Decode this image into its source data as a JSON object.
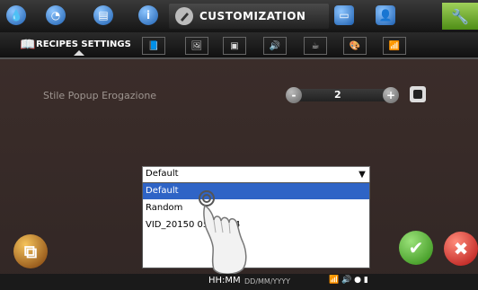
{
  "top": {
    "active_tab": "CUSTOMIZATION",
    "icons": [
      "water-drop-icon",
      "clock-icon",
      "card-icon",
      "info-icon",
      "monitor-icon",
      "user-icon",
      "wrench-icon"
    ]
  },
  "subnav": {
    "active": "RECIPES SETTINGS",
    "icons": [
      "book-icon",
      "image-icon",
      "screen-icon",
      "speaker-icon",
      "cup-icon",
      "palette-icon",
      "wifi-icon"
    ]
  },
  "setting": {
    "label": "Stile Popup Erogazione",
    "value": "2",
    "minus": "-",
    "plus": "+"
  },
  "dropdown": {
    "selected": "Default",
    "options": [
      "Default",
      "Random",
      "VID_20150 05 9.mp4"
    ]
  },
  "footer": {
    "time": "HH:MM",
    "date": "DD/MM/YYYY"
  },
  "colors": {
    "panel": "#3b2d2a",
    "accent_green": "#4f8e16",
    "accent_red": "#b31111",
    "accent_blue": "#2f64c6",
    "copy_button": "#7b3b09"
  }
}
